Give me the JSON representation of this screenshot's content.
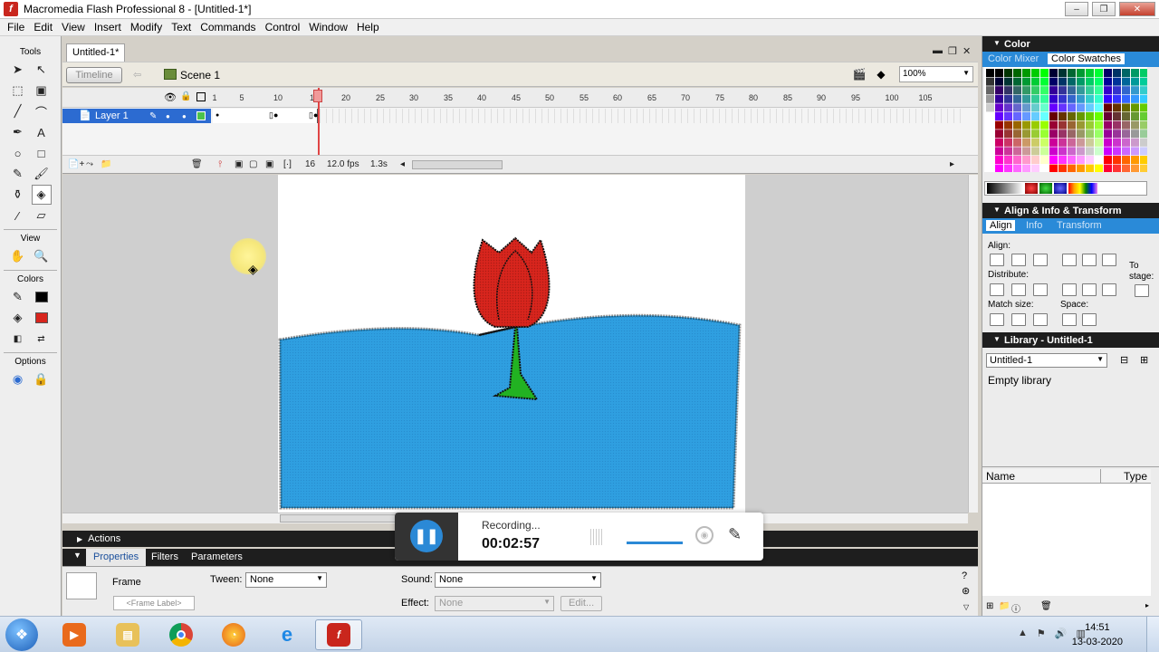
{
  "window": {
    "title": "Macromedia Flash Professional 8 - [Untitled-1*]",
    "minimize": "–",
    "restore": "❐",
    "close": "✕"
  },
  "menu": [
    "File",
    "Edit",
    "View",
    "Insert",
    "Modify",
    "Text",
    "Commands",
    "Control",
    "Window",
    "Help"
  ],
  "tools_panel": {
    "label": "Tools",
    "view_label": "View",
    "colors_label": "Colors",
    "options_label": "Options"
  },
  "document": {
    "tab": "Untitled-1*",
    "timeline_button": "Timeline",
    "scene": "Scene 1",
    "zoom": "100%"
  },
  "timeline": {
    "layer_name": "Layer 1",
    "ruler_ticks": [
      "1",
      "5",
      "10",
      "15",
      "20",
      "25",
      "30",
      "35",
      "40",
      "45",
      "50",
      "55",
      "60",
      "65",
      "70",
      "75",
      "80",
      "85",
      "90",
      "95",
      "100",
      "105"
    ],
    "current_frame": "16",
    "frame_rate": "12.0 fps",
    "elapsed": "1.3s"
  },
  "actions_panel": {
    "label": "Actions"
  },
  "properties_panel": {
    "tabs": [
      "Properties",
      "Filters",
      "Parameters"
    ],
    "frame_label": "Frame",
    "frame_label_placeholder": "<Frame Label>",
    "tween_label": "Tween:",
    "tween_value": "None",
    "sound_label": "Sound:",
    "sound_value": "None",
    "effect_label": "Effect:",
    "effect_value": "None",
    "edit_button": "Edit..."
  },
  "recorder": {
    "status": "Recording...",
    "time": "00:02:57"
  },
  "color_panel": {
    "title": "Color",
    "tabs": [
      "Color Mixer",
      "Color Swatches"
    ],
    "active_tab": "Color Swatches"
  },
  "align_panel": {
    "title": "Align & Info & Transform",
    "tabs": [
      "Align",
      "Info",
      "Transform"
    ],
    "align_label": "Align:",
    "distribute_label": "Distribute:",
    "match_size_label": "Match size:",
    "space_label": "Space:",
    "to_stage_label": "To stage:"
  },
  "library_panel": {
    "title": "Library - Untitled-1",
    "selected_doc": "Untitled-1",
    "empty_text": "Empty library",
    "col_name": "Name",
    "col_type": "Type"
  },
  "taskbar": {
    "time": "14:51",
    "date": "13-03-2020",
    "apps": [
      "media-player",
      "file-explorer",
      "chrome",
      "firefox",
      "internet-explorer",
      "flash"
    ]
  },
  "colors": {
    "accent": "#2c6bd1",
    "water": "#2f9fe0",
    "tulip": "#d8251d",
    "stem": "#22b222",
    "record_blue": "#2b89d6"
  }
}
